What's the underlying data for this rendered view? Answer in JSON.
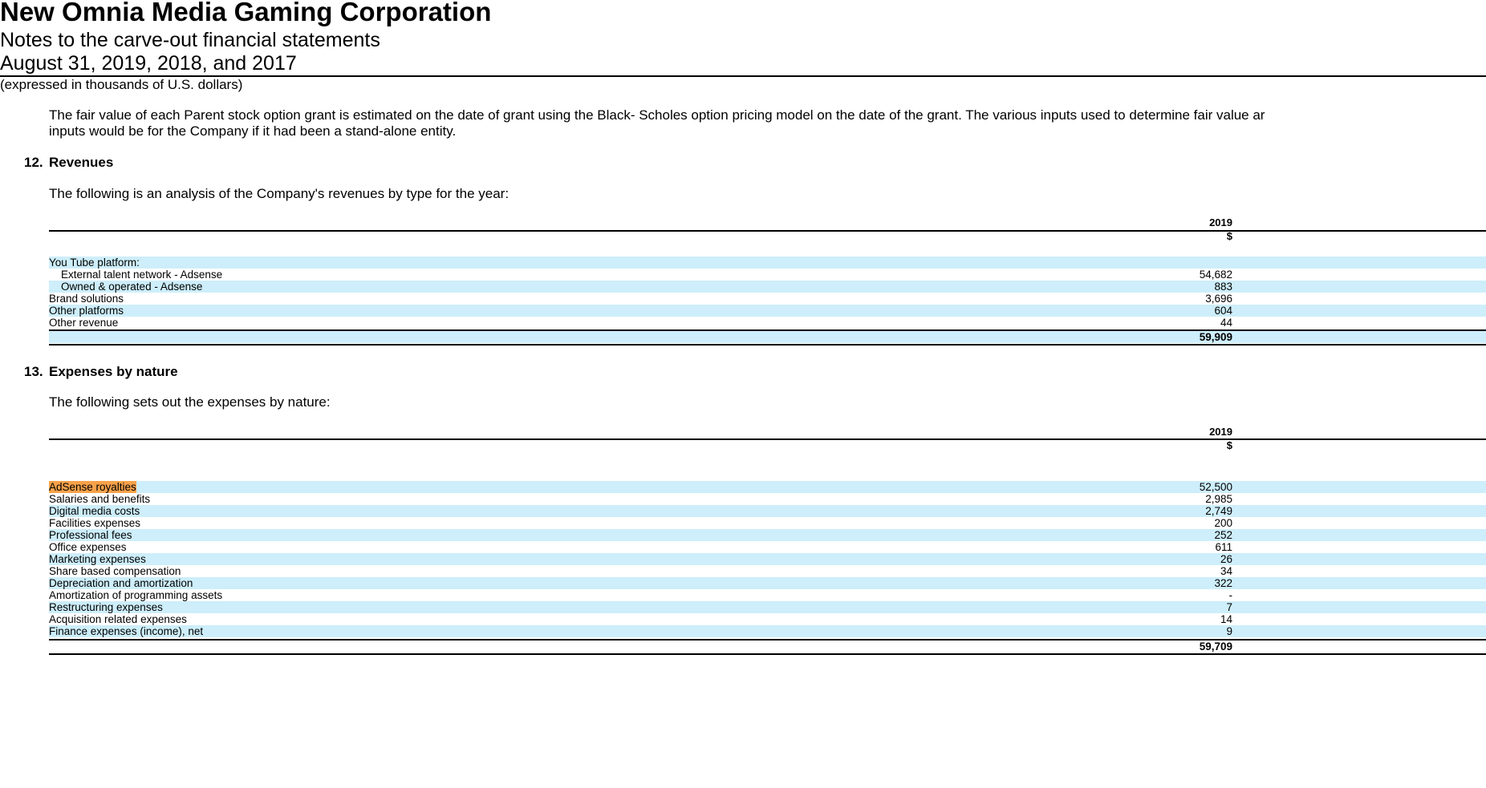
{
  "header": {
    "company": "New Omnia Media Gaming Corporation",
    "subtitle": "Notes to the carve-out financial statements",
    "period": "August 31, 2019, 2018, and 2017",
    "units": "(expressed in thousands of U.S. dollars)"
  },
  "intro": {
    "line1": "The fair value of each Parent stock option grant is estimated on the date of grant using the Black- Scholes option pricing model on the date of the grant. The various inputs used to determine fair value ar",
    "line2": "inputs would be for the Company if it had been a stand-alone entity."
  },
  "revenues": {
    "number": "12.",
    "title": "Revenues",
    "description": "The following is an analysis of the Company's revenues by type for the year:",
    "column_year": "2019",
    "column_currency": "$",
    "rows": [
      {
        "label": "You Tube platform:",
        "value": ""
      },
      {
        "label": "External talent network - Adsense",
        "value": "54,682"
      },
      {
        "label": "Owned & operated - Adsense",
        "value": "883"
      },
      {
        "label": "Brand solutions",
        "value": "3,696"
      },
      {
        "label": "Other platforms",
        "value": "604"
      },
      {
        "label": "Other revenue",
        "value": "44"
      }
    ],
    "total": "59,909"
  },
  "expenses": {
    "number": "13.",
    "title": "Expenses by nature",
    "description": "The following sets out the expenses by nature:",
    "column_year": "2019",
    "column_currency": "$",
    "rows": [
      {
        "label": "AdSense royalties",
        "value": "52,500"
      },
      {
        "label": "Salaries and benefits",
        "value": "2,985"
      },
      {
        "label": "Digital media costs",
        "value": "2,749"
      },
      {
        "label": "Facilities expenses",
        "value": "200"
      },
      {
        "label": "Professional fees",
        "value": "252"
      },
      {
        "label": "Office expenses",
        "value": "611"
      },
      {
        "label": "Marketing expenses",
        "value": "26"
      },
      {
        "label": "Share based compensation",
        "value": "34"
      },
      {
        "label": "Depreciation and amortization",
        "value": "322"
      },
      {
        "label": "Amortization of programming assets",
        "value": "-"
      },
      {
        "label": "Restructuring expenses",
        "value": "7"
      },
      {
        "label": "Acquisition related expenses",
        "value": "14"
      },
      {
        "label": "Finance expenses (income), net",
        "value": "9"
      }
    ],
    "total": "59,709"
  },
  "colors": {
    "row_shade": "#cdeefa",
    "search_highlight": "#f7a24a"
  }
}
